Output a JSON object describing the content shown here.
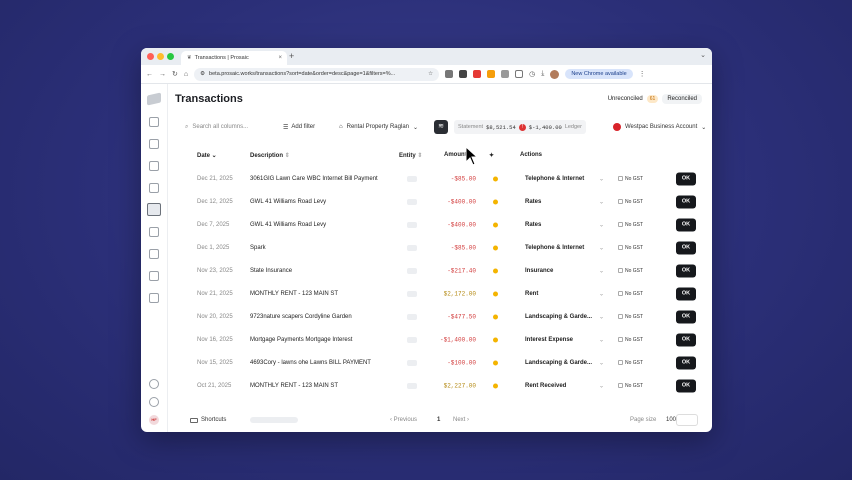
{
  "browser": {
    "tab_title": "Transactions | Prosaic",
    "url": "beta.prosaic.works/transactions?sort=date&order=desc&page=1&filters=%...",
    "chrome_available": "New Chrome available"
  },
  "page": {
    "title": "Transactions",
    "unreconciled_label": "Unreconciled",
    "unreconciled_count": "61",
    "reconciled_label": "Reconciled"
  },
  "filters": {
    "search_placeholder": "Search all columns...",
    "add_filter": "Add filter",
    "property": "Rental Property Raglan",
    "statement_label": "Statement",
    "statement_value": "$8,521.54",
    "ledger_value": "$-1,400.00",
    "ledger_label": "Ledger",
    "bank_account": "Westpac Business Account"
  },
  "columns": {
    "date": "Date",
    "description": "Description",
    "entity": "Entity",
    "amount": "Amount",
    "actions": "Actions"
  },
  "rows": [
    {
      "date": "Dec 21, 2025",
      "description": "3061GIG Lawn Care WBC Internet Bill Payment",
      "amount": "-$85.00",
      "sign": "neg",
      "category": "Telephone & Internet",
      "gst": "No GST",
      "action": "OK"
    },
    {
      "date": "Dec 12, 2025",
      "description": "GWL 41 Williams Road Levy",
      "amount": "-$400.00",
      "sign": "neg",
      "category": "Rates",
      "gst": "No GST",
      "action": "OK"
    },
    {
      "date": "Dec 7, 2025",
      "description": "GWL 41 Williams Road Levy",
      "amount": "-$400.00",
      "sign": "neg",
      "category": "Rates",
      "gst": "No GST",
      "action": "OK"
    },
    {
      "date": "Dec 1, 2025",
      "description": "Spark",
      "amount": "-$85.00",
      "sign": "neg",
      "category": "Telephone & Internet",
      "gst": "No GST",
      "action": "OK"
    },
    {
      "date": "Nov 23, 2025",
      "description": "State Insurance",
      "amount": "-$217.40",
      "sign": "neg",
      "category": "Insurance",
      "gst": "No GST",
      "action": "OK"
    },
    {
      "date": "Nov 21, 2025",
      "description": "MONTHLY RENT - 123 MAIN ST",
      "amount": "$2,172.00",
      "sign": "pos",
      "category": "Rent",
      "gst": "No GST",
      "action": "OK"
    },
    {
      "date": "Nov 20, 2025",
      "description": "9723nature scapers Cordyline Garden",
      "amount": "-$477.50",
      "sign": "neg",
      "category": "Landscaping & Garde...",
      "gst": "No GST",
      "action": "OK"
    },
    {
      "date": "Nov 16, 2025",
      "description": "Mortgage Payments Mortgage Interest",
      "amount": "-$1,400.00",
      "sign": "neg",
      "category": "Interest Expense",
      "gst": "No GST",
      "action": "OK"
    },
    {
      "date": "Nov 15, 2025",
      "description": "4693Cory - lawns ohe Lawns BILL PAYMENT",
      "amount": "-$100.00",
      "sign": "neg",
      "category": "Landscaping & Garde...",
      "gst": "No GST",
      "action": "OK"
    },
    {
      "date": "Oct 21, 2025",
      "description": "MONTHLY RENT - 123 MAIN ST",
      "amount": "$2,227.00",
      "sign": "pos",
      "category": "Rent Received",
      "gst": "No GST",
      "action": "OK"
    }
  ],
  "footer": {
    "shortcuts": "Shortcuts",
    "previous": "Previous",
    "page": "1",
    "next": "Next",
    "page_size_label": "Page size",
    "page_size": "100"
  },
  "user": {
    "initials": "HF"
  }
}
